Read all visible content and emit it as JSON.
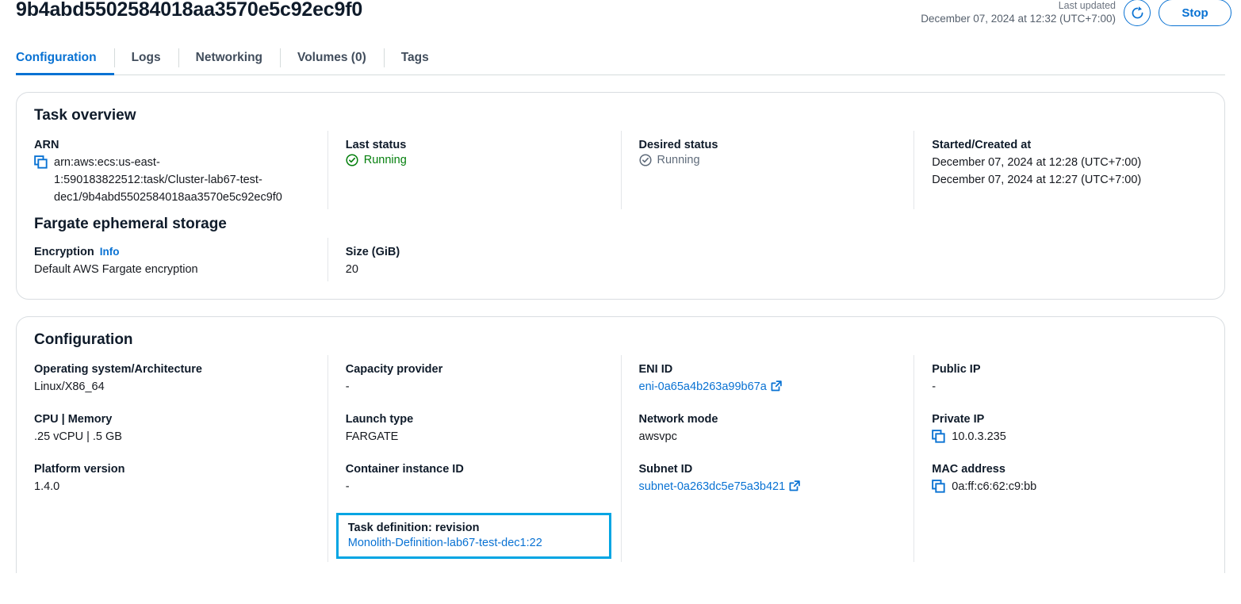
{
  "header": {
    "title": "9b4abd5502584018aa3570e5c92ec9f0",
    "last_updated_label": "Last updated",
    "last_updated_time": "December 07, 2024 at 12:32 (UTC+7:00)",
    "refresh_icon": "refresh-icon",
    "stop_label": "Stop"
  },
  "tabs": [
    {
      "label": "Configuration",
      "active": true
    },
    {
      "label": "Logs",
      "active": false
    },
    {
      "label": "Networking",
      "active": false
    },
    {
      "label": "Volumes (0)",
      "active": false
    },
    {
      "label": "Tags",
      "active": false
    }
  ],
  "task_overview": {
    "title": "Task overview",
    "arn_label": "ARN",
    "arn_value": "arn:aws:ecs:us-east-1:590183822512:task/Cluster-lab67-test-dec1/9b4abd5502584018aa3570e5c92ec9f0",
    "last_status_label": "Last status",
    "last_status_value": "Running",
    "desired_status_label": "Desired status",
    "desired_status_value": "Running",
    "started_label": "Started/Created at",
    "started_at": "December 07, 2024 at 12:28 (UTC+7:00)",
    "created_at": "December 07, 2024 at 12:27 (UTC+7:00)"
  },
  "ephemeral_storage": {
    "title": "Fargate ephemeral storage",
    "encryption_label": "Encryption",
    "encryption_info": "Info",
    "encryption_value": "Default AWS Fargate encryption",
    "size_label": "Size (GiB)",
    "size_value": "20"
  },
  "configuration": {
    "title": "Configuration",
    "os_label": "Operating system/Architecture",
    "os_value": "Linux/X86_64",
    "cpu_label": "CPU | Memory",
    "cpu_value": ".25 vCPU | .5 GB",
    "platform_label": "Platform version",
    "platform_value": "1.4.0",
    "capacity_label": "Capacity provider",
    "capacity_value": "-",
    "launch_label": "Launch type",
    "launch_value": "FARGATE",
    "container_instance_label": "Container instance ID",
    "container_instance_value": "-",
    "task_def_label": "Task definition: revision",
    "task_def_value": "Monolith-Definition-lab67-test-dec1:22",
    "eni_label": "ENI ID",
    "eni_value": "eni-0a65a4b263a99b67a",
    "network_mode_label": "Network mode",
    "network_mode_value": "awsvpc",
    "subnet_label": "Subnet ID",
    "subnet_value": "subnet-0a263dc5e75a3b421",
    "public_ip_label": "Public IP",
    "public_ip_value": "-",
    "private_ip_label": "Private IP",
    "private_ip_value": "10.0.3.235",
    "mac_label": "MAC address",
    "mac_value": "0a:ff:c6:62:c9:bb"
  },
  "colors": {
    "accent_blue": "#0972d3",
    "highlight": "#00a5e3",
    "status_green": "#037f0c",
    "status_gray": "#5f6b7a"
  }
}
